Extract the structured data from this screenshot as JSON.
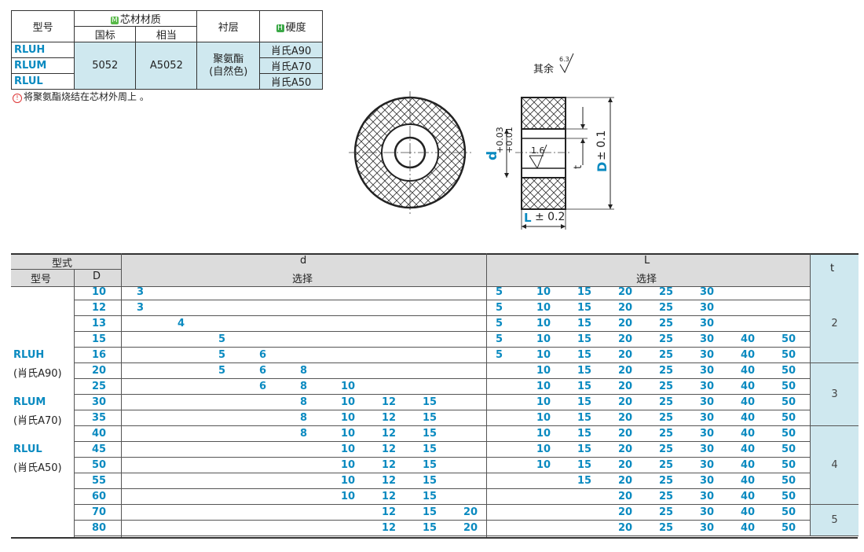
{
  "material_table": {
    "headers": {
      "model": "型号",
      "core": "芯材材质",
      "core_tag": "M",
      "gb": "国标",
      "equiv": "相当",
      "liner": "衬层",
      "hard": "硬度",
      "hard_tag": "H"
    },
    "models": [
      "RLUH",
      "RLUM",
      "RLUL"
    ],
    "gb_value": "5052",
    "equiv_value": "A5052",
    "liner_value": "聚氨酯\n(自然色)",
    "hardness": [
      "肖氏A90",
      "肖氏A70",
      "肖氏A50"
    ],
    "note": "将聚氨酯烧结在芯材外周上 。"
  },
  "drawing": {
    "rest_roughness": "其余",
    "roughness_63": "6.3",
    "roughness_16": "1.6",
    "d_label": "d",
    "d_tol_upper": "+0.03",
    "d_tol_lower": "+0.01",
    "D_label": "D",
    "D_tol": "± 0.1",
    "L_label": "L",
    "L_tol": "± 0.2",
    "t_label": "t"
  },
  "dim_table": {
    "h_type": "型式",
    "h_d": "d",
    "h_L": "L",
    "h_t": "t",
    "h_model": "型号",
    "h_D": "D",
    "h_select": "选择",
    "model_labels": [
      "RLUH",
      "(肖氏A90)",
      "RLUM",
      "(肖氏A70)",
      "RLUL",
      "(肖氏A50)"
    ],
    "d_options": [
      "3",
      "4",
      "5",
      "6",
      "8",
      "10",
      "12",
      "15",
      "20"
    ],
    "L_options": [
      "5",
      "10",
      "15",
      "20",
      "25",
      "30",
      "40",
      "50"
    ],
    "rows": [
      {
        "D": "10",
        "d": [
          "3"
        ],
        "L": [
          "5",
          "10",
          "15",
          "20",
          "25",
          "30"
        ]
      },
      {
        "D": "12",
        "d": [
          "3"
        ],
        "L": [
          "5",
          "10",
          "15",
          "20",
          "25",
          "30"
        ]
      },
      {
        "D": "13",
        "d": [
          "4"
        ],
        "L": [
          "5",
          "10",
          "15",
          "20",
          "25",
          "30"
        ]
      },
      {
        "D": "15",
        "d": [
          "5"
        ],
        "L": [
          "5",
          "10",
          "15",
          "20",
          "25",
          "30",
          "40",
          "50"
        ]
      },
      {
        "D": "16",
        "d": [
          "5",
          "6"
        ],
        "L": [
          "5",
          "10",
          "15",
          "20",
          "25",
          "30",
          "40",
          "50"
        ]
      },
      {
        "D": "20",
        "d": [
          "5",
          "6",
          "8"
        ],
        "L": [
          "10",
          "15",
          "20",
          "25",
          "30",
          "40",
          "50"
        ]
      },
      {
        "D": "25",
        "d": [
          "6",
          "8",
          "10"
        ],
        "L": [
          "10",
          "15",
          "20",
          "25",
          "30",
          "40",
          "50"
        ]
      },
      {
        "D": "30",
        "d": [
          "8",
          "10",
          "12",
          "15"
        ],
        "L": [
          "10",
          "15",
          "20",
          "25",
          "30",
          "40",
          "50"
        ]
      },
      {
        "D": "35",
        "d": [
          "8",
          "10",
          "12",
          "15"
        ],
        "L": [
          "10",
          "15",
          "20",
          "25",
          "30",
          "40",
          "50"
        ]
      },
      {
        "D": "40",
        "d": [
          "8",
          "10",
          "12",
          "15"
        ],
        "L": [
          "10",
          "15",
          "20",
          "25",
          "30",
          "40",
          "50"
        ]
      },
      {
        "D": "45",
        "d": [
          "10",
          "12",
          "15"
        ],
        "L": [
          "10",
          "15",
          "20",
          "25",
          "30",
          "40",
          "50"
        ]
      },
      {
        "D": "50",
        "d": [
          "10",
          "12",
          "15"
        ],
        "L": [
          "10",
          "15",
          "20",
          "25",
          "30",
          "40",
          "50"
        ]
      },
      {
        "D": "55",
        "d": [
          "10",
          "12",
          "15"
        ],
        "L": [
          "15",
          "20",
          "25",
          "30",
          "40",
          "50"
        ]
      },
      {
        "D": "60",
        "d": [
          "10",
          "12",
          "15"
        ],
        "L": [
          "20",
          "25",
          "30",
          "40",
          "50"
        ]
      },
      {
        "D": "70",
        "d": [
          "12",
          "15",
          "20"
        ],
        "L": [
          "20",
          "25",
          "30",
          "40",
          "50"
        ]
      },
      {
        "D": "80",
        "d": [
          "12",
          "15",
          "20"
        ],
        "L": [
          "20",
          "25",
          "30",
          "40",
          "50"
        ]
      }
    ],
    "t_groups": [
      {
        "value": "2",
        "rows": 5
      },
      {
        "value": "3",
        "rows": 4
      },
      {
        "value": "4",
        "rows": 5
      },
      {
        "value": "5",
        "rows": 2
      }
    ]
  }
}
